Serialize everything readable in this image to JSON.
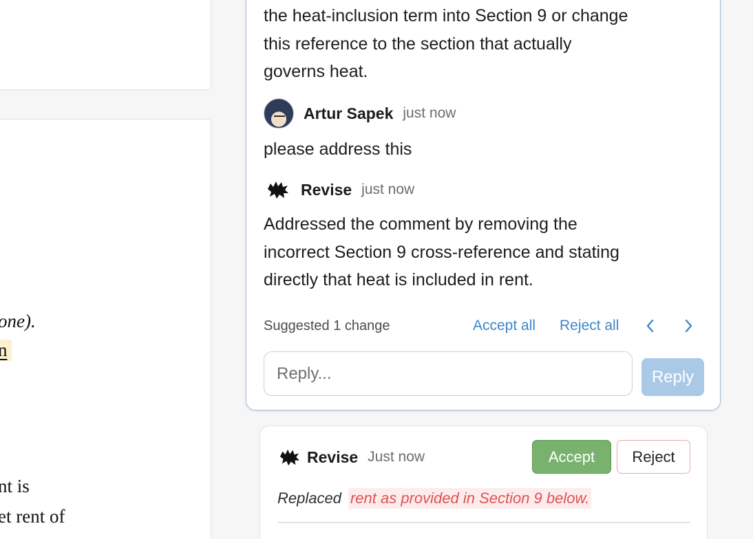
{
  "document": {
    "lines": [
      "one).",
      "n",
      "nt is",
      "et rent of"
    ]
  },
  "thread": {
    "original_comment_lines": [
      "the heat-inclusion term into Section 9 or change",
      "this reference to the section that actually",
      "governs heat."
    ],
    "reply": {
      "author": "Artur Sapek",
      "time": "just now",
      "text": "please address this"
    },
    "bot_reply": {
      "author": "Revise",
      "time": "just now",
      "text_lines": [
        "Addressed the comment by removing the",
        "incorrect Section 9 cross-reference and stating",
        "directly that heat is included in rent."
      ]
    },
    "suggested_label": "Suggested 1 change",
    "accept_all_label": "Accept all",
    "reject_all_label": "Reject all",
    "reply_placeholder": "Reply...",
    "reply_button_label": "Reply"
  },
  "suggestion": {
    "author": "Revise",
    "time": "Just now",
    "accept_label": "Accept",
    "reject_label": "Reject",
    "replaced_label": "Replaced",
    "deleted_text": "rent as provided in Section 9 below."
  },
  "colors": {
    "accent": "#3d86c6",
    "accept": "#79b26f",
    "reject_border": "#e9a7a7",
    "deletion": "#e05252"
  }
}
